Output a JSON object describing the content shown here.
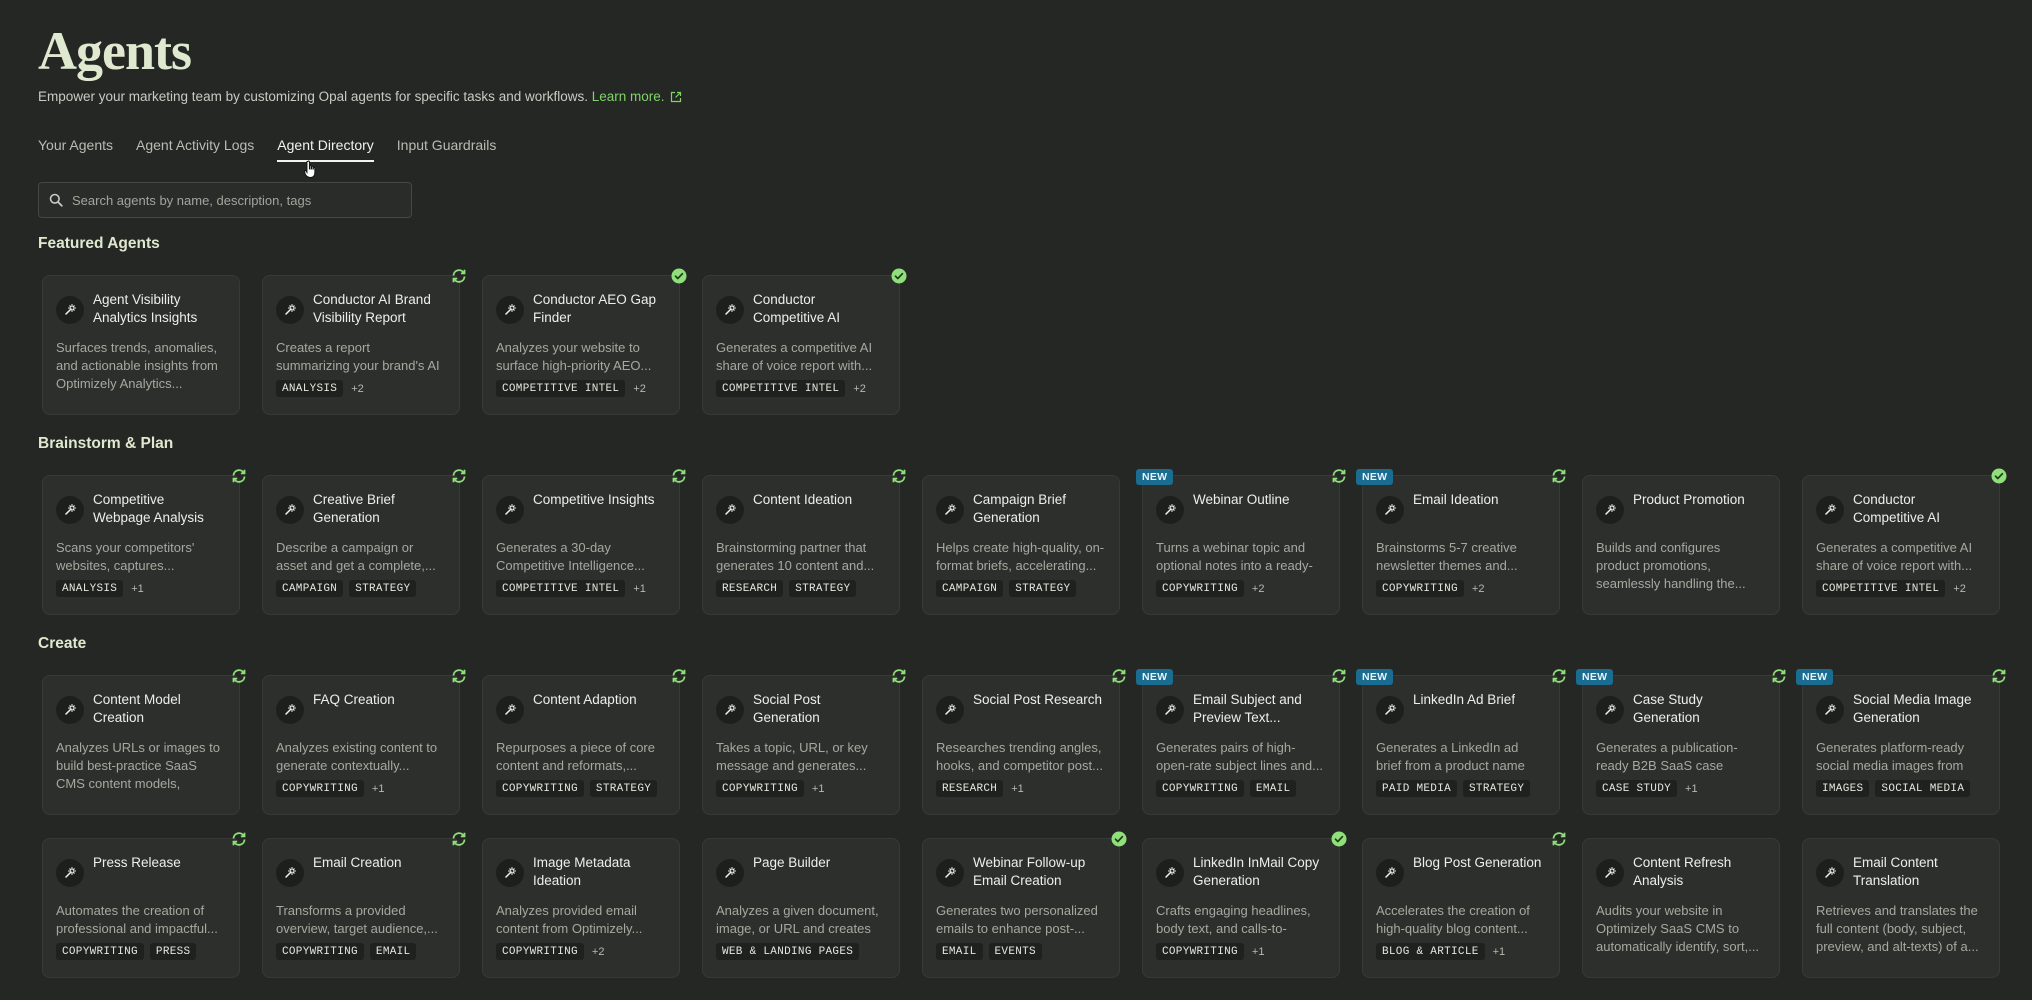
{
  "header": {
    "title": "Agents",
    "subtitle": "Empower your marketing team by customizing Opal agents for specific tasks and workflows.",
    "learn_more": "Learn more."
  },
  "tabs": [
    {
      "label": "Your Agents",
      "active": false
    },
    {
      "label": "Agent Activity Logs",
      "active": false
    },
    {
      "label": "Agent Directory",
      "active": true
    },
    {
      "label": "Input Guardrails",
      "active": false
    }
  ],
  "search": {
    "placeholder": "Search agents by name, description, tags"
  },
  "colors": {
    "accent": "#7fd469",
    "new_badge": "#1a6c90",
    "sync_icon": "#8fe07a",
    "check_icon": "#8fe07a"
  },
  "sections": [
    {
      "title": "Featured Agents",
      "rows": [
        [
          {
            "name": "Agent Visibility Analytics Insights",
            "desc": "Surfaces trends, anomalies, and actionable insights from Optimizely Analytics...",
            "tags": [],
            "more": "",
            "status": "",
            "new": false
          },
          {
            "name": "Conductor AI Brand Visibility Report",
            "desc": "Creates a report summarizing your brand's AI search...",
            "tags": [
              "ANALYSIS"
            ],
            "more": "+2",
            "status": "sync",
            "new": false
          },
          {
            "name": "Conductor AEO Gap Finder",
            "desc": "Analyzes your website to surface high-priority AEO...",
            "tags": [
              "COMPETITIVE INTEL"
            ],
            "more": "+2",
            "status": "check",
            "new": false
          },
          {
            "name": "Conductor Competitive AI Share...",
            "desc": "Generates a competitive AI share of voice report with...",
            "tags": [
              "COMPETITIVE INTEL"
            ],
            "more": "+2",
            "status": "check",
            "new": false
          }
        ]
      ]
    },
    {
      "title": "Brainstorm & Plan",
      "rows": [
        [
          {
            "name": "Competitive Webpage Analysis",
            "desc": "Scans your competitors' websites, captures...",
            "tags": [
              "ANALYSIS"
            ],
            "more": "+1",
            "status": "sync",
            "new": false
          },
          {
            "name": "Creative Brief Generation",
            "desc": "Describe a campaign or asset and get a complete,...",
            "tags": [
              "CAMPAIGN",
              "STRATEGY"
            ],
            "more": "",
            "status": "sync",
            "new": false
          },
          {
            "name": "Competitive Insights",
            "desc": "Generates a 30-day Competitive Intelligence...",
            "tags": [
              "COMPETITIVE INTEL"
            ],
            "more": "+1",
            "status": "sync",
            "new": false
          },
          {
            "name": "Content Ideation",
            "desc": "Brainstorming partner that generates 10 content and...",
            "tags": [
              "RESEARCH",
              "STRATEGY"
            ],
            "more": "",
            "status": "sync",
            "new": false
          },
          {
            "name": "Campaign Brief Generation",
            "desc": "Helps create high-quality, on-format briefs, accelerating...",
            "tags": [
              "CAMPAIGN",
              "STRATEGY"
            ],
            "more": "",
            "status": "",
            "new": false
          },
          {
            "name": "Webinar Outline",
            "desc": "Turns a webinar topic and optional notes into a ready-t...",
            "tags": [
              "COPYWRITING"
            ],
            "more": "+2",
            "status": "sync",
            "new": true
          },
          {
            "name": "Email Ideation",
            "desc": "Brainstorms 5-7 creative newsletter themes and...",
            "tags": [
              "COPYWRITING"
            ],
            "more": "+2",
            "status": "sync",
            "new": true
          },
          {
            "name": "Product Promotion",
            "desc": "Builds and configures product promotions, seamlessly handling the...",
            "tags": [],
            "more": "",
            "status": "",
            "new": false
          },
          {
            "name": "Conductor Competitive AI Share...",
            "desc": "Generates a competitive AI share of voice report with...",
            "tags": [
              "COMPETITIVE INTEL"
            ],
            "more": "+2",
            "status": "check",
            "new": false
          }
        ]
      ]
    },
    {
      "title": "Create",
      "rows": [
        [
          {
            "name": "Content Model Creation",
            "desc": "Analyzes URLs or images to build best-practice SaaS CMS content models, referencing...",
            "tags": [],
            "more": "",
            "status": "sync",
            "new": false
          },
          {
            "name": "FAQ Creation",
            "desc": "Analyzes existing content to generate contextually...",
            "tags": [
              "COPYWRITING"
            ],
            "more": "+1",
            "status": "sync",
            "new": false
          },
          {
            "name": "Content Adaption",
            "desc": "Repurposes a piece of core content and reformats,...",
            "tags": [
              "COPYWRITING",
              "STRATEGY"
            ],
            "more": "",
            "status": "sync",
            "new": false
          },
          {
            "name": "Social Post Generation",
            "desc": "Takes a topic, URL, or key message and generates...",
            "tags": [
              "COPYWRITING"
            ],
            "more": "+1",
            "status": "sync",
            "new": false
          },
          {
            "name": "Social Post Research",
            "desc": "Researches trending angles, hooks, and competitor post...",
            "tags": [
              "RESEARCH"
            ],
            "more": "+1",
            "status": "sync",
            "new": false
          },
          {
            "name": "Email Subject and Preview Text...",
            "desc": "Generates pairs of high-open-rate subject lines and...",
            "tags": [
              "COPYWRITING",
              "EMAIL"
            ],
            "more": "",
            "status": "sync",
            "new": true
          },
          {
            "name": "LinkedIn Ad Brief",
            "desc": "Generates a LinkedIn ad brief from a product name and...",
            "tags": [
              "PAID MEDIA",
              "STRATEGY"
            ],
            "more": "",
            "status": "sync",
            "new": true
          },
          {
            "name": "Case Study Generation",
            "desc": "Generates a publication-ready B2B SaaS case study...",
            "tags": [
              "CASE STUDY"
            ],
            "more": "+1",
            "status": "sync",
            "new": true
          },
          {
            "name": "Social Media Image Generation",
            "desc": "Generates platform-ready social media images from a...",
            "tags": [
              "IMAGES",
              "SOCIAL MEDIA"
            ],
            "more": "",
            "status": "sync",
            "new": true
          }
        ],
        [
          {
            "name": "Press Release",
            "desc": "Automates the creation of professional and impactful...",
            "tags": [
              "COPYWRITING",
              "PRESS"
            ],
            "more": "",
            "status": "sync",
            "new": false
          },
          {
            "name": "Email Creation",
            "desc": "Transforms a provided overview, target audience,...",
            "tags": [
              "COPYWRITING",
              "EMAIL"
            ],
            "more": "",
            "status": "sync",
            "new": false
          },
          {
            "name": "Image Metadata Ideation",
            "desc": "Analyzes provided email content from Optimizely...",
            "tags": [
              "COPYWRITING"
            ],
            "more": "+2",
            "status": "",
            "new": false
          },
          {
            "name": "Page Builder",
            "desc": "Analyzes a given document, image, or URL and creates a...",
            "tags": [
              "WEB & LANDING PAGES"
            ],
            "more": "",
            "status": "",
            "new": false
          },
          {
            "name": "Webinar Follow-up Email Creation",
            "desc": "Generates two personalized emails to enhance post-...",
            "tags": [
              "EMAIL",
              "EVENTS"
            ],
            "more": "",
            "status": "check",
            "new": false
          },
          {
            "name": "LinkedIn InMail Copy Generation",
            "desc": "Crafts engaging headlines, body text, and calls-to-actio...",
            "tags": [
              "COPYWRITING"
            ],
            "more": "+1",
            "status": "check",
            "new": false
          },
          {
            "name": "Blog Post Generation",
            "desc": "Accelerates the creation of high-quality blog content...",
            "tags": [
              "BLOG & ARTICLE"
            ],
            "more": "+1",
            "status": "sync",
            "new": false
          },
          {
            "name": "Content Refresh Analysis",
            "desc": "Audits your website in Optimizely SaaS CMS to automatically identify, sort,...",
            "tags": [],
            "more": "",
            "status": "",
            "new": false
          },
          {
            "name": "Email Content Translation",
            "desc": "Retrieves and translates the full content (body, subject, preview, and alt-texts) of a...",
            "tags": [],
            "more": "",
            "status": "",
            "new": false
          }
        ]
      ]
    }
  ],
  "new_badge_label": "NEW"
}
